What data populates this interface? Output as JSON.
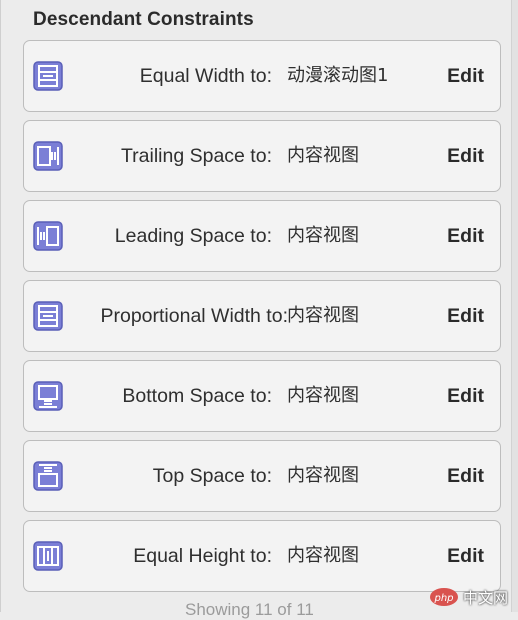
{
  "section": {
    "title": "Descendant Constraints"
  },
  "constraints": [
    {
      "label": "Equal Width to:",
      "target": "动漫滚动图1",
      "edit_label": "Edit",
      "icon": "equal-width-icon"
    },
    {
      "label": "Trailing Space to:",
      "target": "内容视图",
      "edit_label": "Edit",
      "icon": "trailing-space-icon"
    },
    {
      "label": "Leading Space to:",
      "target": "内容视图",
      "edit_label": "Edit",
      "icon": "leading-space-icon"
    },
    {
      "label": "Proportional Width to:",
      "target": "内容视图",
      "edit_label": "Edit",
      "icon": "proportional-width-icon"
    },
    {
      "label": "Bottom Space to:",
      "target": "内容视图",
      "edit_label": "Edit",
      "icon": "bottom-space-icon"
    },
    {
      "label": "Top Space to:",
      "target": "内容视图",
      "edit_label": "Edit",
      "icon": "top-space-icon"
    },
    {
      "label": "Equal Height to:",
      "target": "内容视图",
      "edit_label": "Edit",
      "icon": "equal-height-icon"
    }
  ],
  "footer": {
    "status": "Showing 11 of 11"
  },
  "watermark": {
    "text": "中文网",
    "logo_text": "php"
  },
  "colors": {
    "icon_fill": "#7b7fd6",
    "icon_border": "#5a5fb8",
    "row_border": "#bdbdbd",
    "row_background": "#f3f3f3",
    "panel_background": "#ececec"
  }
}
